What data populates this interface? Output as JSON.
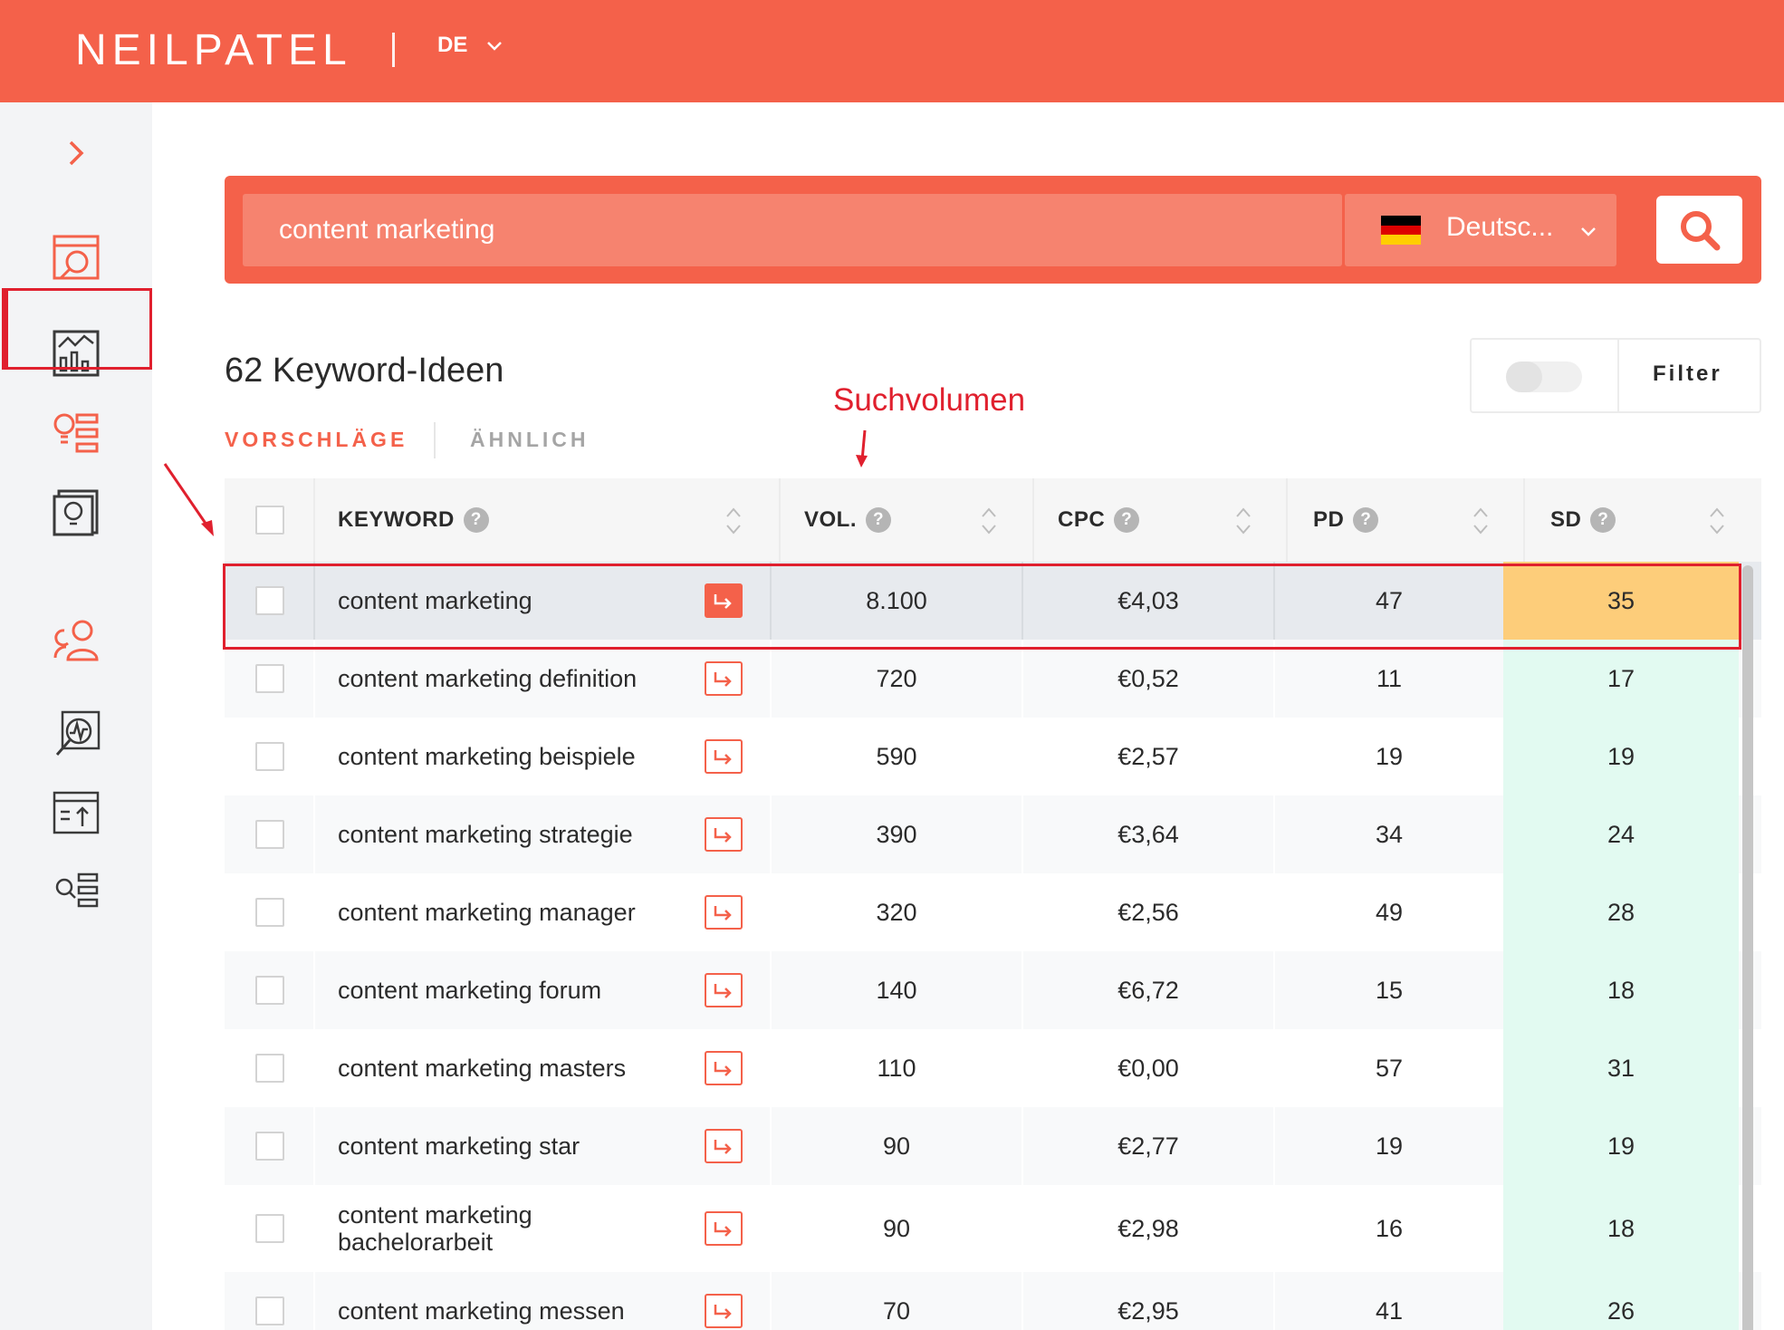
{
  "header": {
    "logo": "NEILPATEL",
    "language": "DE"
  },
  "search": {
    "query": "content marketing",
    "country": "Deutsc...",
    "flag_colors": [
      "#000000",
      "#dd0000",
      "#ffce00"
    ]
  },
  "results": {
    "title": "62 Keyword-Ideen",
    "tabs": [
      {
        "label": "VORSCHLÄGE",
        "active": true
      },
      {
        "label": "ÄHNLICH",
        "active": false
      }
    ],
    "filter_label": "Filter"
  },
  "annotation": {
    "label": "Suchvolumen",
    "color": "#e0202e"
  },
  "table": {
    "columns": [
      {
        "label": "KEYWORD",
        "help": "?"
      },
      {
        "label": "VOL.",
        "help": "?"
      },
      {
        "label": "CPC",
        "help": "?"
      },
      {
        "label": "PD",
        "help": "?"
      },
      {
        "label": "SD",
        "help": "?"
      }
    ],
    "rows": [
      {
        "keyword": "content marketing",
        "vol": "8.100",
        "cpc": "€4,03",
        "pd": "47",
        "sd": "35"
      },
      {
        "keyword": "content marketing definition",
        "vol": "720",
        "cpc": "€0,52",
        "pd": "11",
        "sd": "17"
      },
      {
        "keyword": "content marketing beispiele",
        "vol": "590",
        "cpc": "€2,57",
        "pd": "19",
        "sd": "19"
      },
      {
        "keyword": "content marketing strategie",
        "vol": "390",
        "cpc": "€3,64",
        "pd": "34",
        "sd": "24"
      },
      {
        "keyword": "content marketing manager",
        "vol": "320",
        "cpc": "€2,56",
        "pd": "49",
        "sd": "28"
      },
      {
        "keyword": "content marketing forum",
        "vol": "140",
        "cpc": "€6,72",
        "pd": "15",
        "sd": "18"
      },
      {
        "keyword": "content marketing masters",
        "vol": "110",
        "cpc": "€0,00",
        "pd": "57",
        "sd": "31"
      },
      {
        "keyword": "content marketing star",
        "vol": "90",
        "cpc": "€2,77",
        "pd": "19",
        "sd": "19"
      },
      {
        "keyword": "content marketing bachelorarbeit",
        "vol": "90",
        "cpc": "€2,98",
        "pd": "16",
        "sd": "18"
      },
      {
        "keyword": "content marketing messen",
        "vol": "70",
        "cpc": "€2,95",
        "pd": "41",
        "sd": "26"
      }
    ]
  },
  "colors": {
    "brand": "#f4614a",
    "sd_easy": "#e2faf1",
    "sd_medium": "#fdcd7a"
  }
}
